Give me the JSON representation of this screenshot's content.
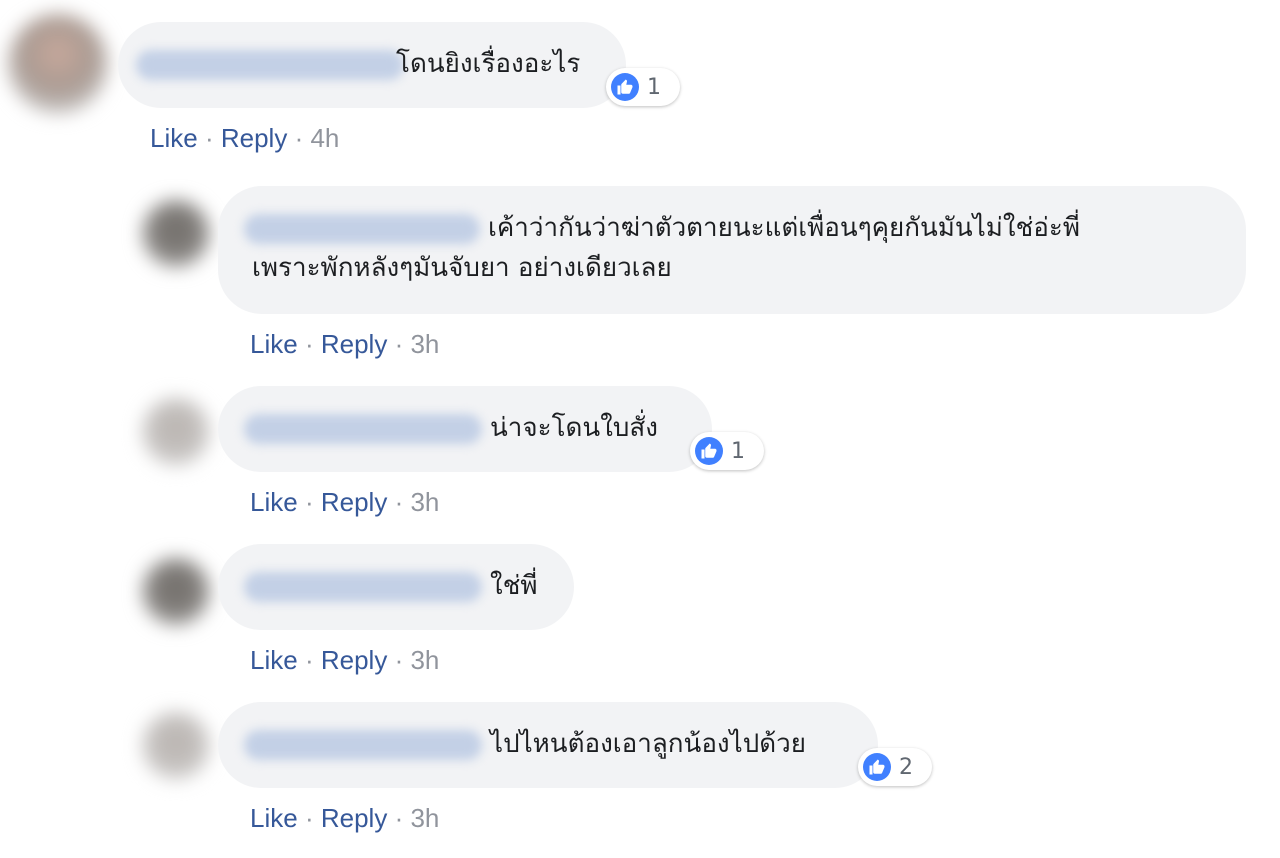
{
  "comments": [
    {
      "text": "โดนยิงเรื่องอะไร",
      "reactions": "1",
      "like_label": "Like",
      "reply_label": "Reply",
      "separator": "·",
      "time": "4h"
    },
    {
      "text": "เค้าว่ากันว่าฆ่าตัวตายนะแต่เพื่อนๆคุยกันมันไม่ใช่อ่ะพี่ เพราะพักหลังๆมันจับยา อย่างเดียวเลย",
      "like_label": "Like",
      "reply_label": "Reply",
      "separator": "·",
      "time": "3h"
    },
    {
      "text": "น่าจะโดนใบสั่ง",
      "reactions": "1",
      "like_label": "Like",
      "reply_label": "Reply",
      "separator": "·",
      "time": "3h"
    },
    {
      "text": "ใช่พี่",
      "like_label": "Like",
      "reply_label": "Reply",
      "separator": "·",
      "time": "3h"
    },
    {
      "text": "ไปไหนต้องเอาลูกน้องไปด้วย",
      "reactions": "2",
      "like_label": "Like",
      "reply_label": "Reply",
      "separator": "·",
      "time": "3h"
    }
  ],
  "colors": {
    "bubble": "#f2f3f5",
    "link": "#365899",
    "meta": "#90949c",
    "like_icon": "#4080ff"
  }
}
